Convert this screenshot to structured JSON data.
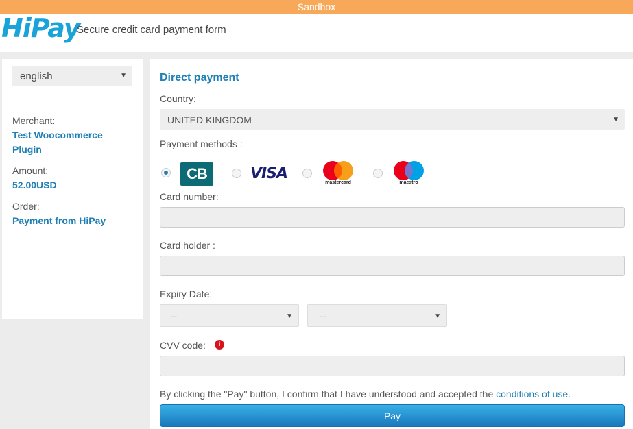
{
  "sandbox": {
    "label": "Sandbox"
  },
  "header": {
    "logo": "HiPay",
    "title": "Secure credit card payment form"
  },
  "sidebar": {
    "language": "english",
    "merchant_label": "Merchant:",
    "merchant_value": "Test Woocommerce Plugin",
    "amount_label": "Amount:",
    "amount_value": "52.00USD",
    "order_label": "Order:",
    "order_value": "Payment from HiPay"
  },
  "form": {
    "title": "Direct payment",
    "country_label": "Country:",
    "country_value": "UNITED KINGDOM",
    "payment_methods_label": "Payment methods :",
    "payment_methods": [
      {
        "name": "CB",
        "logo_text": "CB",
        "selected": true
      },
      {
        "name": "VISA",
        "logo_text": "VISA",
        "selected": false
      },
      {
        "name": "Mastercard",
        "logo_text": "mastercard",
        "selected": false
      },
      {
        "name": "Maestro",
        "logo_text": "maestro",
        "selected": false
      }
    ],
    "card_number_label": "Card number:",
    "card_holder_label": "Card holder :",
    "expiry_label": "Expiry Date:",
    "expiry_month": "--",
    "expiry_year": "--",
    "cvv_label": "CVV code:",
    "cvv_info_icon": "i",
    "consent_text": "By clicking the \"Pay\" button, I confirm that I have understood and accepted the",
    "consent_link": "conditions of use.",
    "pay_label": "Pay"
  },
  "colors": {
    "sandbox_bar": "#f7a959",
    "accent": "#1f7fb4",
    "logo": "#1aa3d9",
    "pay_button": "#1a78bc"
  }
}
